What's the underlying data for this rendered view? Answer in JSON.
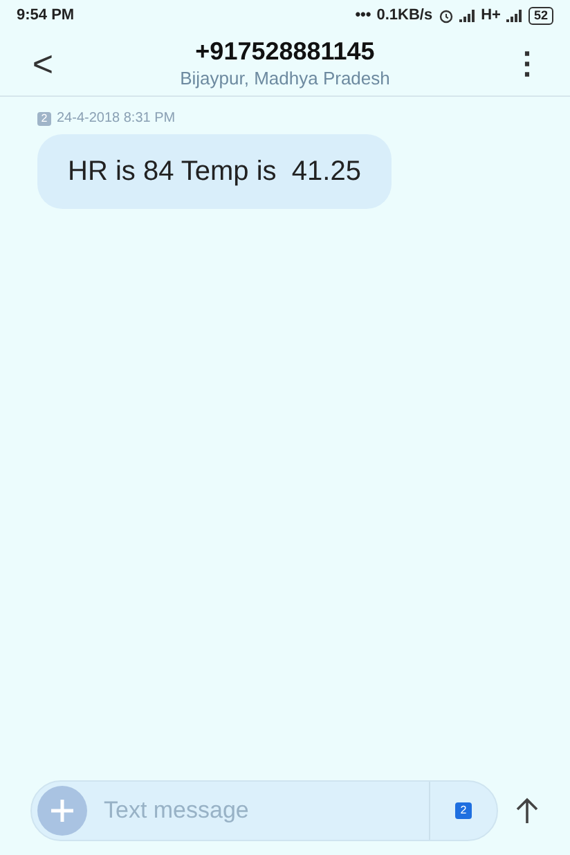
{
  "status_bar": {
    "time": "9:54 PM",
    "dots": "•••",
    "speed": "0.1KB/s",
    "network": "H+",
    "battery": "52"
  },
  "header": {
    "back": "<",
    "number": "+917528881145",
    "location": "Bijaypur, Madhya Pradesh",
    "menu": "⋮"
  },
  "messages": [
    {
      "sim": "2",
      "time": "24-4-2018 8:31 PM",
      "text": "HR is 84 Temp is  41.25"
    }
  ],
  "composer": {
    "placeholder": "Text message",
    "sim": "2"
  }
}
